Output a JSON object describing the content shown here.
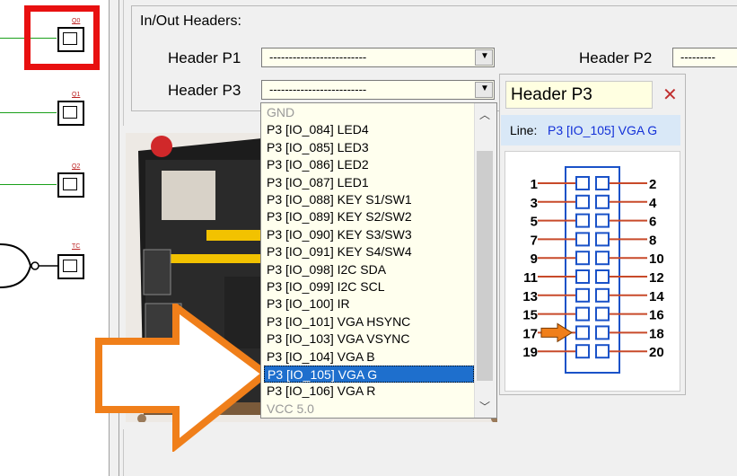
{
  "schematic": {
    "gate_labels": [
      "Q0",
      "Q1",
      "Q2",
      "TC"
    ]
  },
  "io_headers": {
    "title": "In/Out Headers:",
    "header_p1": {
      "label": "Header P1",
      "value": "-------------------------"
    },
    "header_p2": {
      "label": "Header P2",
      "value": "---------"
    },
    "header_p3": {
      "label": "Header P3",
      "value": "-------------------------"
    }
  },
  "dropdown": {
    "items": [
      "GND",
      "P3 [IO_084] LED4",
      "P3 [IO_085] LED3",
      "P3 [IO_086] LED2",
      "P3 [IO_087] LED1",
      "P3 [IO_088] KEY S1/SW1",
      "P3 [IO_089] KEY S2/SW2",
      "P3 [IO_090] KEY S3/SW3",
      "P3 [IO_091] KEY S4/SW4",
      "P3 [IO_098] I2C SDA",
      "P3 [IO_099] I2C SCL",
      "P3 [IO_100] IR",
      "P3 [IO_101] VGA HSYNC",
      "P3 [IO_103] VGA VSYNC",
      "P3 [IO_104] VGA B",
      "P3 [IO_105] VGA G",
      "P3 [IO_106] VGA R",
      "VCC 5.0"
    ],
    "selected_index": 15,
    "disabled_indices": [
      0,
      17
    ]
  },
  "info": {
    "header_name": "Header P3",
    "line_label": "Line:",
    "line_value": "P3 [IO_105] VGA G",
    "pins_left": [
      "1",
      "3",
      "5",
      "7",
      "9",
      "11",
      "13",
      "15",
      "17",
      "19"
    ],
    "pins_right": [
      "2",
      "4",
      "6",
      "8",
      "10",
      "12",
      "14",
      "16",
      "18",
      "20"
    ],
    "highlighted_pin": "17"
  },
  "colors": {
    "highlight_red": "#e81010",
    "arrow_orange": "#f07f1a",
    "selection_blue": "#1e6fcd",
    "pin_blue": "#1a52c8",
    "pin_red": "#c84a2a",
    "line_value_blue": "#1230d8"
  }
}
